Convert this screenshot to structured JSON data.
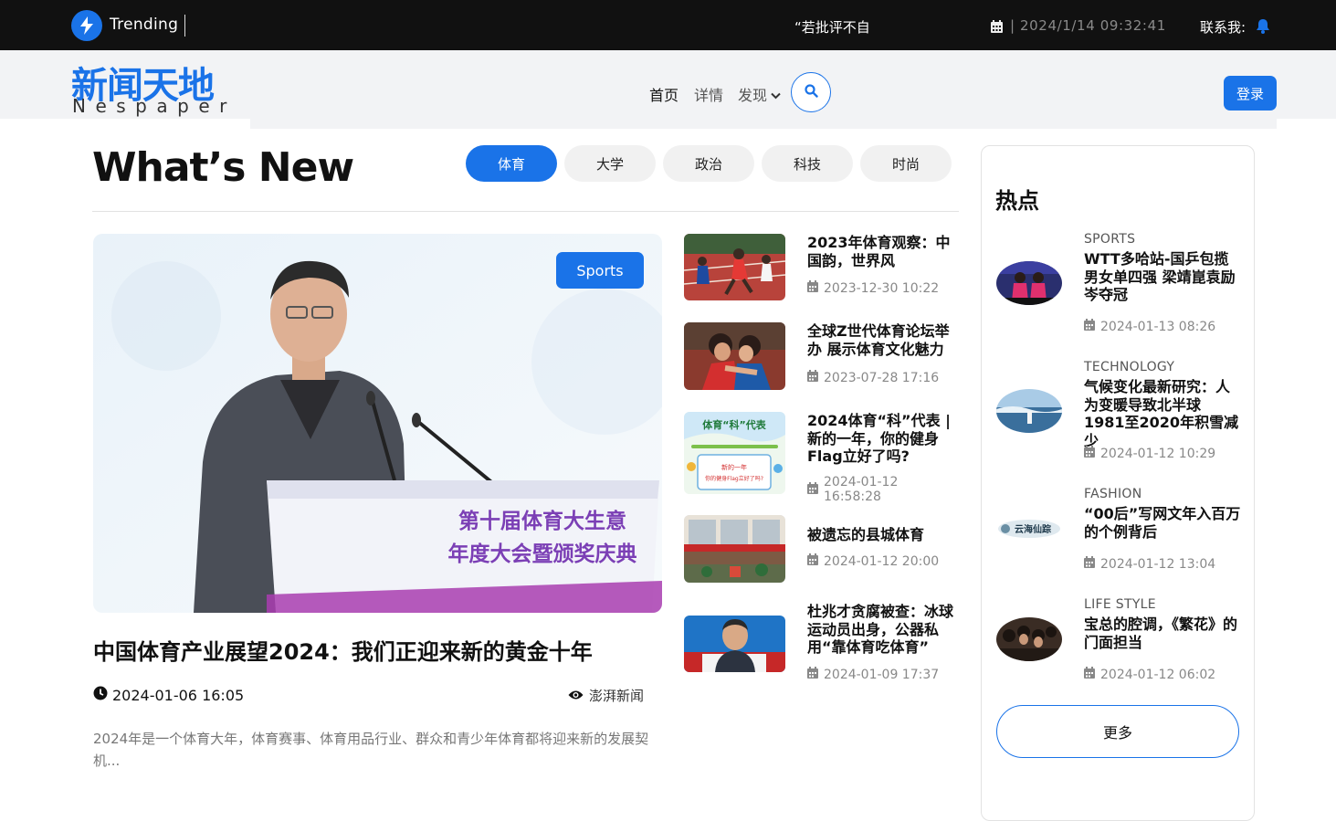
{
  "topbar": {
    "trending_label": "Trending",
    "ticker_text": "“若批评不自",
    "datetime": "| 2024/1/14 09:32:41",
    "contact_label": "联系我:"
  },
  "header": {
    "logo_text": "新闻天地",
    "logo_sub": "Nespaper",
    "nav_home": "首页",
    "nav_detail": "详情",
    "nav_discover": "发现",
    "login_label": "登录"
  },
  "whats_new": {
    "title": "What’s New",
    "tabs": [
      "体育",
      "大学",
      "政治",
      "科技",
      "时尚"
    ],
    "active_tab": "体育"
  },
  "featured": {
    "badge": "Sports",
    "podium_line1": "第十届体育大生意",
    "podium_line2": "年度大会暨颁奖庆典",
    "title": "中国体育产业展望2024：我们正迎来新的黄金十年",
    "date": "2024-01-06 16:05",
    "source": "澎湃新闻",
    "description": "2024年是一个体育大年，体育赛事、体育用品行业、群众和青少年体育都将迎来新的发展契机..."
  },
  "mid_list": [
    {
      "title": "2023年体育观察：中国韵，世界风",
      "date": "2023-12-30 10:22"
    },
    {
      "title": "全球Z世代体育论坛举办 展示体育文化魅力",
      "date": "2023-07-28 17:16"
    },
    {
      "title": "2024体育“科”代表 | 新的一年，你的健身Flag立好了吗?",
      "date": "2024-01-12 16:58:28",
      "thumb_text1": "体育“科”代表",
      "thumb_text2": "新的一年",
      "thumb_text3": "你的健身Flag立好了吗?"
    },
    {
      "title": "被遗忘的县城体育",
      "date": "2024-01-12 20:00"
    },
    {
      "title": "杜兆才贪腐被查：冰球运动员出身，公器私用“靠体育吃体育”",
      "date": "2024-01-09 17:37"
    }
  ],
  "sidebar": {
    "title": "热点",
    "items": [
      {
        "category": "SPORTS",
        "title": "WTT多哈站-国乒包揽男女单四强 梁靖崑袁励岑夺冠",
        "date": "2024-01-13 08:26"
      },
      {
        "category": "TECHNOLOGY",
        "title": "气候变化最新研究：人为变暖导致北半球1981至2020年积雪减少",
        "date": "2024-01-12 10:29"
      },
      {
        "category": "FASHION",
        "title": "“00后”写网文年入百万的个例背后",
        "date": "2024-01-12 13:04",
        "thumb_text": "云海仙踪"
      },
      {
        "category": "LIFE STYLE",
        "title": "宝总的腔调，《繁花》的门面担当",
        "date": "2024-01-12 06:02"
      }
    ],
    "more_label": "更多"
  },
  "colors": {
    "accent": "#1a73e8",
    "topbar_bg": "#111111",
    "header_bg": "#f2f3f5"
  },
  "icons": [
    "bolt-icon",
    "calendar-icon",
    "bell-icon",
    "search-icon",
    "chevron-down-icon",
    "clock-icon",
    "eye-icon"
  ]
}
